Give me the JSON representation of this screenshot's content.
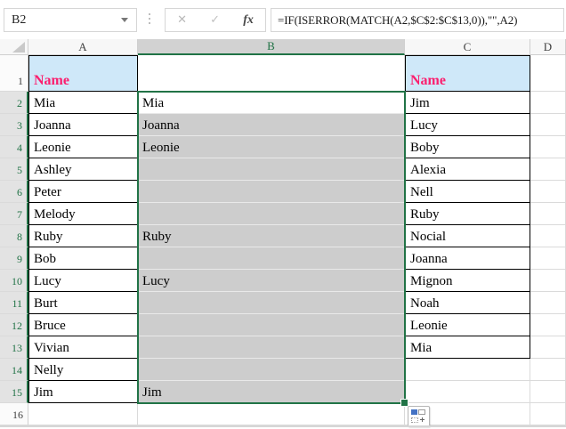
{
  "formula_bar": {
    "name_box_value": "B2",
    "cancel_label": "✕",
    "enter_label": "✓",
    "fx_label": "fx",
    "formula": "=IF(ISERROR(MATCH(A2,$C$2:$C$13,0)),\"\",A2)"
  },
  "sheet": {
    "column_headers": [
      "A",
      "B",
      "C",
      "D"
    ],
    "selected_column": "B",
    "active_cell": "B2",
    "selected_range": "B2:B15",
    "rows": [
      {
        "num": 1,
        "a": "Name",
        "b": "",
        "c": "Name"
      },
      {
        "num": 2,
        "a": "Mia",
        "b": "Mia",
        "c": "Jim"
      },
      {
        "num": 3,
        "a": "Joanna",
        "b": "Joanna",
        "c": "Lucy"
      },
      {
        "num": 4,
        "a": "Leonie",
        "b": "Leonie",
        "c": "Boby"
      },
      {
        "num": 5,
        "a": "Ashley",
        "b": "",
        "c": "Alexia"
      },
      {
        "num": 6,
        "a": "Peter",
        "b": "",
        "c": "Nell"
      },
      {
        "num": 7,
        "a": "Melody",
        "b": "",
        "c": "Ruby"
      },
      {
        "num": 8,
        "a": "Ruby",
        "b": "Ruby",
        "c": "Nocial"
      },
      {
        "num": 9,
        "a": "Bob",
        "b": "",
        "c": "Joanna"
      },
      {
        "num": 10,
        "a": "Lucy",
        "b": "Lucy",
        "c": "Mignon"
      },
      {
        "num": 11,
        "a": "Burt",
        "b": "",
        "c": "Noah"
      },
      {
        "num": 12,
        "a": "Bruce",
        "b": "",
        "c": "Leonie"
      },
      {
        "num": 13,
        "a": "Vivian",
        "b": "",
        "c": "Mia"
      },
      {
        "num": 14,
        "a": "Nelly",
        "b": "",
        "c": ""
      },
      {
        "num": 15,
        "a": "Jim",
        "b": "Jim",
        "c": ""
      },
      {
        "num": 16,
        "a": "",
        "b": "",
        "c": ""
      }
    ]
  },
  "colors": {
    "accent_green": "#217346",
    "selection_fill": "#cdcdcd",
    "header_fill_blue": "#cfe8f9",
    "name_text_pink": "#fb1e6e",
    "autofill_blue": "#4472c4"
  }
}
